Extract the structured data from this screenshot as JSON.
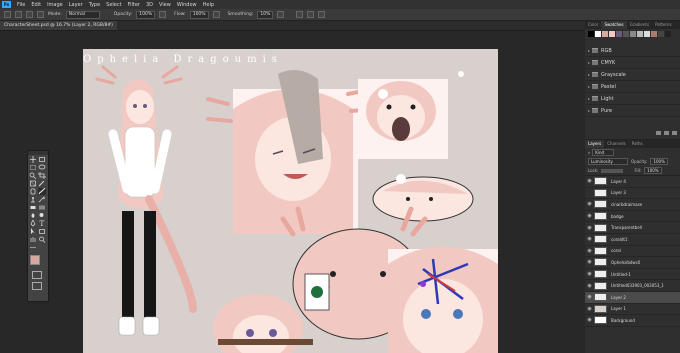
{
  "menu": {
    "items": [
      "File",
      "Edit",
      "Image",
      "Layer",
      "Type",
      "Select",
      "Filter",
      "3D",
      "View",
      "Window",
      "Help"
    ]
  },
  "options_bar": {
    "mode_label": "Mode:",
    "mode_value": "Normal",
    "opacity_label": "Opacity:",
    "opacity_value": "100%",
    "flow_label": "Flow:",
    "flow_value": "100%",
    "smoothing_label": "Smoothing:",
    "smoothing_value": "10%"
  },
  "document": {
    "tab_title": "CharacterSheet.psd @ 16.7% (Layer 2, RGB/8#)"
  },
  "canvas": {
    "character_name": "Ophelia Dragoumis",
    "bg_color": "#d8d0cd",
    "hair_color": "#f2c8c2"
  },
  "panels": {
    "top_tabs": [
      "Color",
      "Swatches",
      "Gradients",
      "Patterns"
    ],
    "swatch_folders": [
      "RGB",
      "CMYK",
      "Grayscale",
      "Pastel",
      "Light",
      "Pure"
    ],
    "layer_tabs": [
      "Layers",
      "Channels",
      "Paths"
    ],
    "kind_label": "Kind",
    "blend_mode": "Luminosity",
    "opacity_label": "Opacity:",
    "opacity_value": "100%",
    "lock_label": "Lock:",
    "fill_label": "Fill:",
    "fill_value": "100%",
    "layers": [
      "Layer 4",
      "Layer 3",
      "cinarbdraimase",
      "badge",
      "Transparentbell",
      "coraldt1",
      "coral",
      "Ophelsi/bdwc0",
      "Untitled-1",
      "Untitled033903_003053_1",
      "Layer 2",
      "Layer 1",
      "Background"
    ]
  }
}
